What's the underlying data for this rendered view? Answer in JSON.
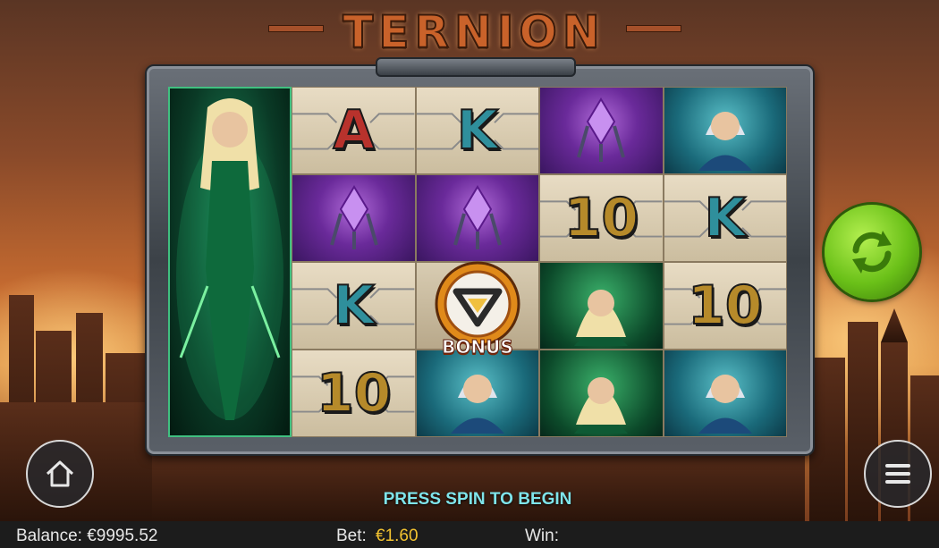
{
  "game": {
    "title": "TERNION"
  },
  "reels": {
    "cells": [
      [
        "",
        "A",
        "K",
        "",
        ""
      ],
      [
        "",
        "",
        "",
        "10",
        "K"
      ],
      [
        "",
        "K",
        "",
        "",
        "10"
      ],
      [
        "",
        "10",
        "",
        "",
        ""
      ]
    ],
    "bonus_label": "BONUS"
  },
  "controls": {
    "spin_icon": "spin-arrows-icon",
    "home_icon": "home-icon",
    "menu_icon": "hamburger-menu-icon"
  },
  "status": {
    "prompt": "PRESS SPIN TO BEGIN"
  },
  "footer": {
    "balance_label": "Balance: €9995.52",
    "bet_label": "Bet:",
    "bet_value": "€1.60",
    "win_label": "Win:"
  },
  "colors": {
    "accent_green": "#6ac018",
    "prompt": "#7fe4ea",
    "bet_value": "#f2c230"
  }
}
